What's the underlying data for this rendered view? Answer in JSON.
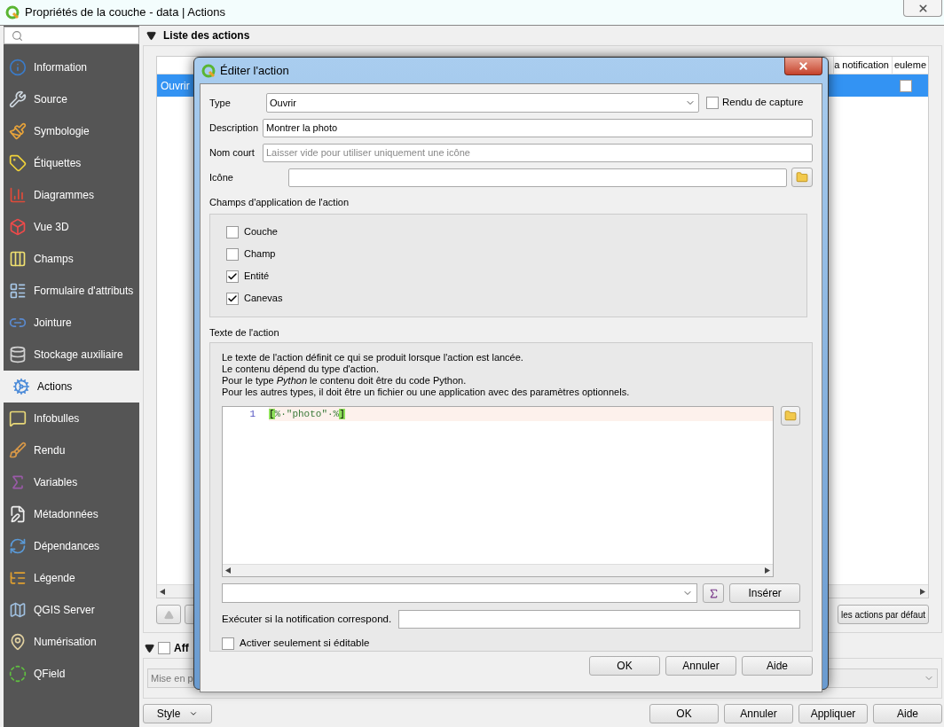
{
  "window": {
    "title": "Propriétés de la couche - data | Actions"
  },
  "sidebar": {
    "items": [
      {
        "label": "Information",
        "selected": false
      },
      {
        "label": "Source",
        "selected": false
      },
      {
        "label": "Symbologie",
        "selected": false
      },
      {
        "label": "Étiquettes",
        "selected": false
      },
      {
        "label": "Diagrammes",
        "selected": false
      },
      {
        "label": "Vue 3D",
        "selected": false
      },
      {
        "label": "Champs",
        "selected": false
      },
      {
        "label": "Formulaire d'attributs",
        "selected": false
      },
      {
        "label": "Jointure",
        "selected": false
      },
      {
        "label": "Stockage auxiliaire",
        "selected": false
      },
      {
        "label": "Actions",
        "selected": true
      },
      {
        "label": "Infobulles",
        "selected": false
      },
      {
        "label": "Rendu",
        "selected": false
      },
      {
        "label": "Variables",
        "selected": false
      },
      {
        "label": "Métadonnées",
        "selected": false
      },
      {
        "label": "Dépendances",
        "selected": false
      },
      {
        "label": "Légende",
        "selected": false
      },
      {
        "label": "QGIS Server",
        "selected": false
      },
      {
        "label": "Numérisation",
        "selected": false
      },
      {
        "label": "QField",
        "selected": false
      }
    ]
  },
  "actions_list": {
    "title": "Liste des actions",
    "expanded": true,
    "table": {
      "columns": [
        "a notification",
        "euleme"
      ],
      "rows": [
        {
          "cell": "Ouvrir",
          "checked": false,
          "selected": true
        }
      ]
    },
    "default_button": "les actions par défaut"
  },
  "display_group": {
    "title": "Aff",
    "checked": false,
    "expanded": true,
    "combo": "Mise en p"
  },
  "footer": {
    "style_button": "Style",
    "buttons": [
      "OK",
      "Annuler",
      "Appliquer",
      "Aide"
    ]
  },
  "dialog": {
    "title": "Éditer l'action",
    "type_label": "Type",
    "type_value": "Ouvrir",
    "capture": {
      "label": "Rendu de capture",
      "checked": false
    },
    "description_label": "Description",
    "description_value": "Montrer la photo",
    "short_name_label": "Nom court",
    "short_name_placeholder": "Laisser vide pour utiliser uniquement une icône",
    "icon_label": "Icône",
    "scopes_title": "Champs d'application de l'action",
    "scopes": [
      {
        "label": "Couche",
        "checked": false
      },
      {
        "label": "Champ",
        "checked": false
      },
      {
        "label": "Entité",
        "checked": true
      },
      {
        "label": "Canevas",
        "checked": true
      }
    ],
    "text_title": "Texte de l'action",
    "help_lines": [
      "Le texte de l'action définit ce qui se produit lorsque l'action est lancée.",
      "Le contenu dépend du type d'action.",
      "Pour le type *Python* le contenu doit être du code Python.",
      "Pour les autres types, il doit être un fichier ou une application avec des paramètres optionnels."
    ],
    "code_lines": [
      {
        "number": "1",
        "text": "[%·\"photo\"·%]"
      }
    ],
    "insert_button": "Insérer",
    "notification_label": "Exécuter si la notification correspond.",
    "editable_only": {
      "label": "Activer seulement si éditable",
      "checked": false
    },
    "buttons": [
      "OK",
      "Annuler",
      "Aide"
    ]
  }
}
